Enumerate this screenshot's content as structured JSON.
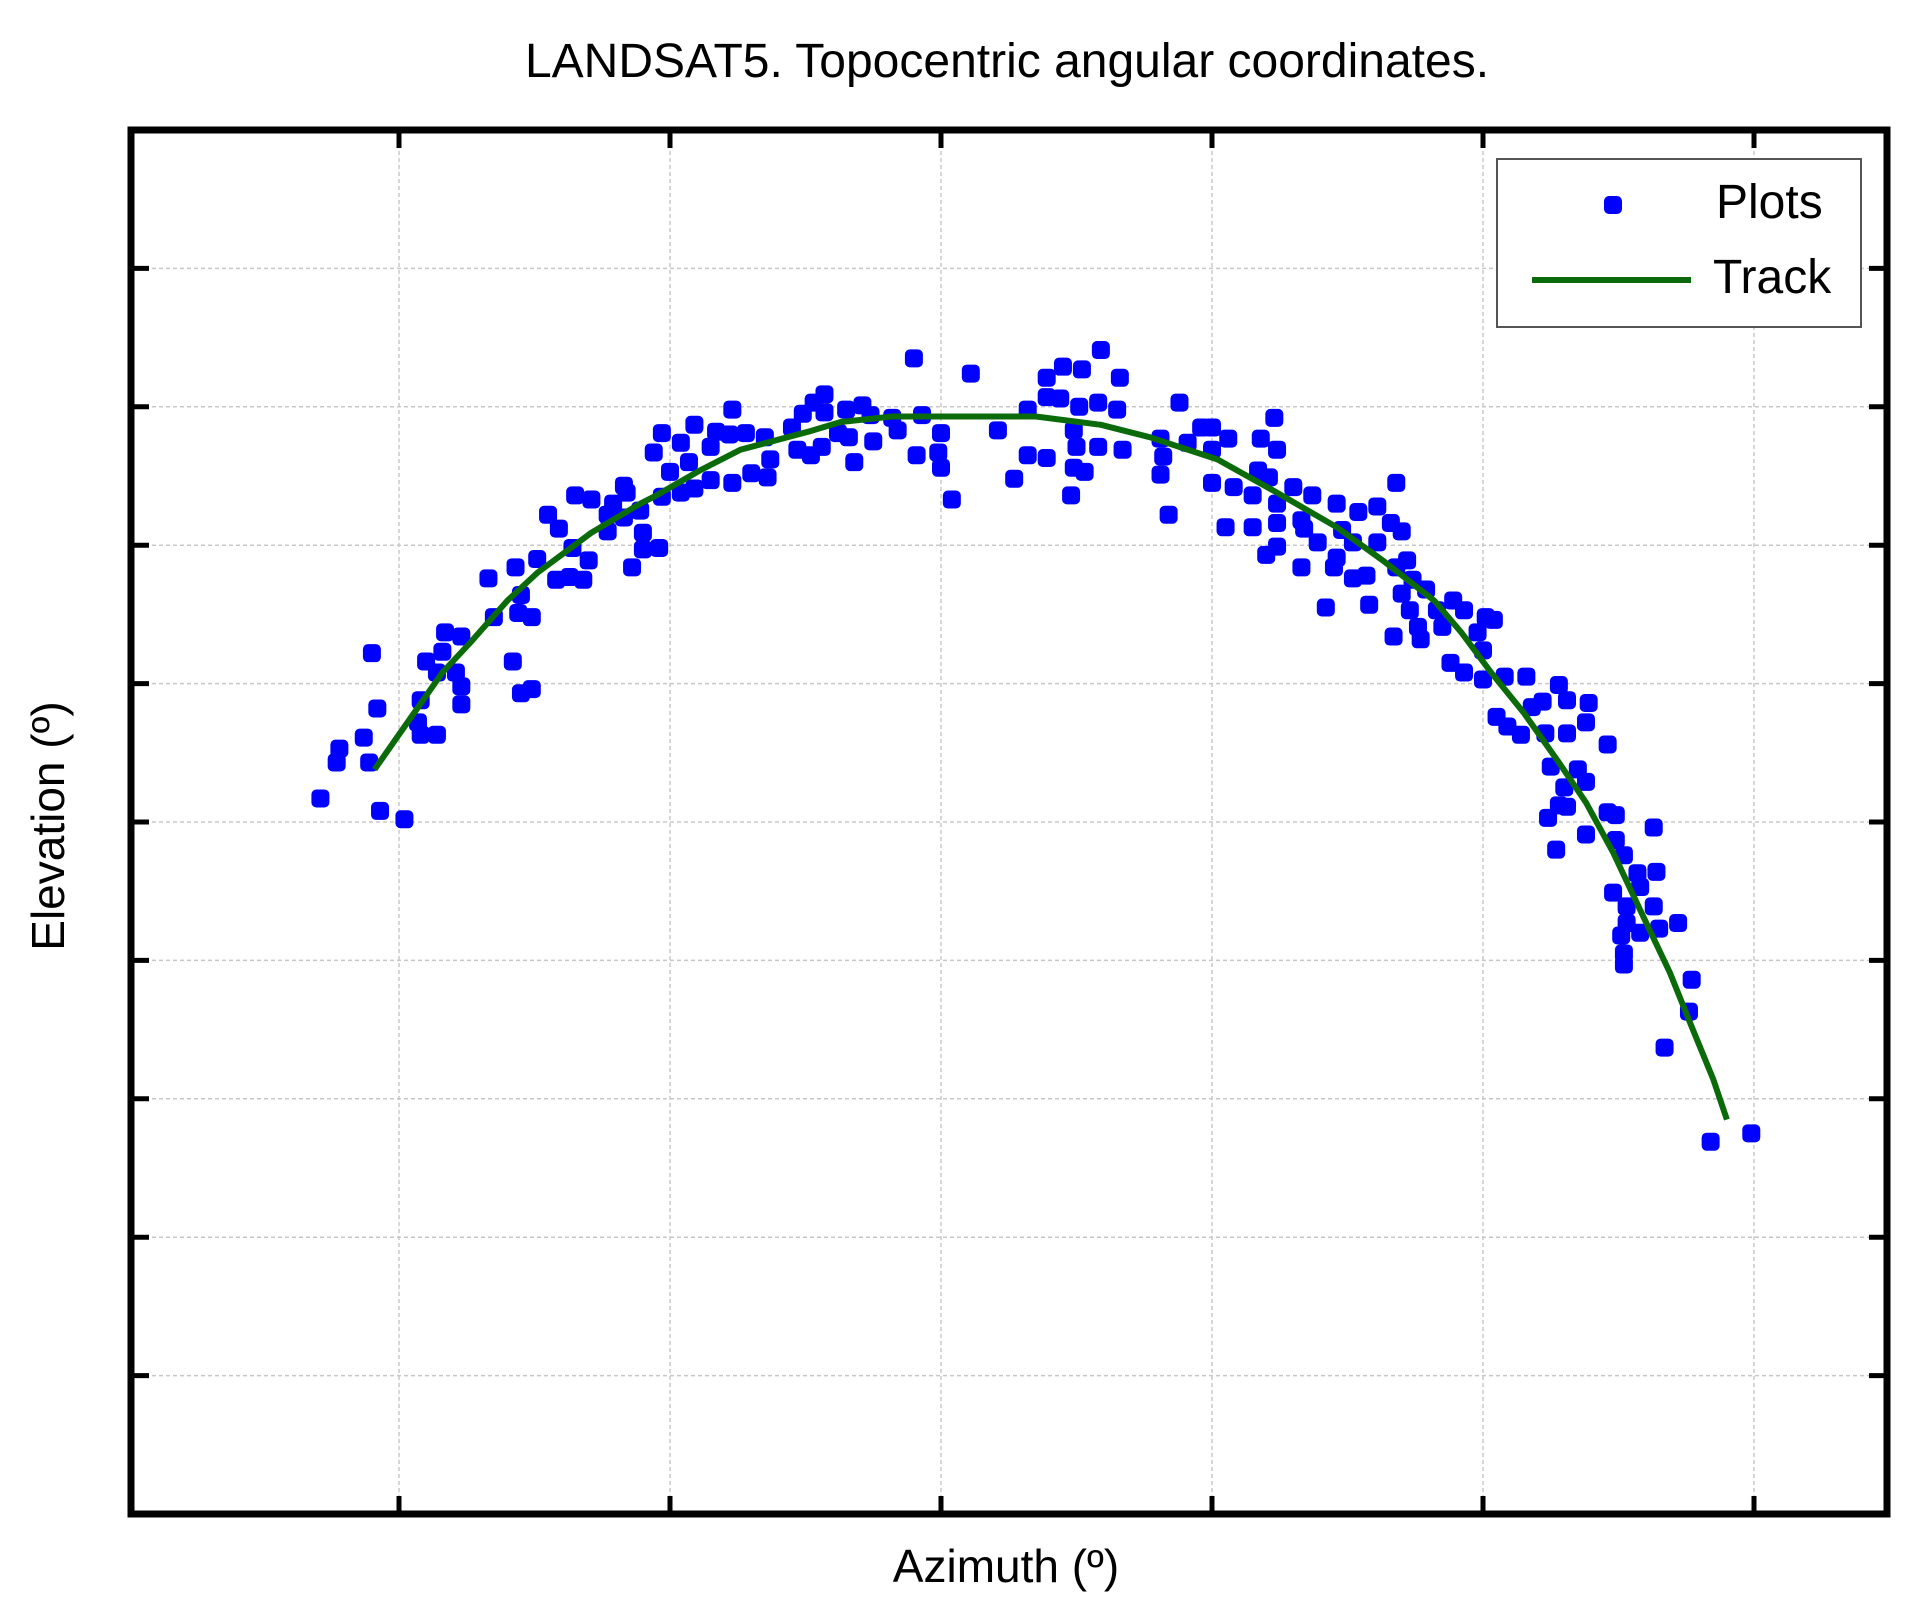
{
  "chart_data": {
    "type": "scatter",
    "title": "LANDSAT5. Topocentric angular coordinates.",
    "xlabel": "Azimuth (º)",
    "ylabel": "Elevation (º)",
    "axis_units_note": "Tick labels are not displayed; values are expressed in grid units (one unit per grid interval).",
    "xlim": [
      0,
      6.5
    ],
    "ylim": [
      0,
      10
    ],
    "xticks": [
      1,
      2,
      3,
      4,
      5,
      6
    ],
    "yticks": [
      1,
      2,
      3,
      4,
      5,
      6,
      7,
      8,
      9
    ],
    "xtick_labels": [
      "",
      "",
      "",
      "",
      "",
      ""
    ],
    "ytick_labels": [
      "",
      "",
      "",
      "",
      "",
      "",
      "",
      "",
      ""
    ],
    "grid": true,
    "legend": {
      "position": "top-right",
      "entries": [
        {
          "label": "Plots",
          "type": "marker",
          "color": "#0000ff"
        },
        {
          "label": "Track",
          "type": "line",
          "color": "#0b6b0b"
        }
      ]
    },
    "series": [
      {
        "name": "Plots",
        "type": "scatter",
        "marker": "rounded-square",
        "color": "#0000ff",
        "points": [
          [
            0.9,
            6.22
          ],
          [
            0.92,
            5.82
          ],
          [
            0.87,
            5.61
          ],
          [
            0.78,
            5.53
          ],
          [
            0.77,
            5.43
          ],
          [
            0.89,
            5.43
          ],
          [
            0.71,
            5.17
          ],
          [
            0.93,
            5.08
          ],
          [
            1.02,
            5.02
          ],
          [
            1.17,
            6.37
          ],
          [
            1.23,
            6.34
          ],
          [
            1.16,
            6.23
          ],
          [
            1.1,
            6.16
          ],
          [
            1.14,
            6.08
          ],
          [
            1.21,
            6.08
          ],
          [
            1.23,
            5.98
          ],
          [
            1.08,
            5.88
          ],
          [
            1.23,
            5.85
          ],
          [
            1.07,
            5.72
          ],
          [
            1.08,
            5.63
          ],
          [
            1.14,
            5.63
          ],
          [
            1.35,
            6.48
          ],
          [
            1.44,
            6.51
          ],
          [
            1.49,
            6.48
          ],
          [
            1.42,
            6.16
          ],
          [
            1.45,
            5.93
          ],
          [
            1.49,
            5.96
          ],
          [
            1.33,
            6.76
          ],
          [
            1.43,
            6.84
          ],
          [
            1.51,
            6.9
          ],
          [
            1.45,
            6.64
          ],
          [
            1.55,
            7.22
          ],
          [
            1.59,
            7.12
          ],
          [
            1.65,
            7.36
          ],
          [
            1.71,
            7.33
          ],
          [
            1.58,
            6.75
          ],
          [
            1.63,
            6.77
          ],
          [
            1.68,
            6.75
          ],
          [
            1.64,
            6.98
          ],
          [
            1.7,
            6.89
          ],
          [
            1.77,
            7.1
          ],
          [
            1.77,
            7.22
          ],
          [
            1.79,
            7.3
          ],
          [
            1.83,
            7.43
          ],
          [
            1.84,
            7.38
          ],
          [
            1.83,
            7.2
          ],
          [
            1.89,
            7.25
          ],
          [
            1.9,
            7.09
          ],
          [
            1.9,
            6.97
          ],
          [
            1.96,
            6.98
          ],
          [
            1.86,
            6.84
          ],
          [
            1.97,
            7.35
          ],
          [
            2.04,
            7.38
          ],
          [
            2.09,
            7.41
          ],
          [
            2.15,
            7.47
          ],
          [
            2.23,
            7.45
          ],
          [
            2.0,
            7.53
          ],
          [
            1.97,
            7.81
          ],
          [
            1.94,
            7.67
          ],
          [
            2.04,
            7.74
          ],
          [
            2.09,
            7.87
          ],
          [
            2.07,
            7.6
          ],
          [
            2.17,
            7.82
          ],
          [
            2.15,
            7.71
          ],
          [
            2.23,
            7.98
          ],
          [
            2.22,
            7.8
          ],
          [
            2.28,
            7.81
          ],
          [
            2.3,
            7.52
          ],
          [
            2.36,
            7.49
          ],
          [
            2.37,
            7.62
          ],
          [
            2.35,
            7.78
          ],
          [
            2.45,
            7.85
          ],
          [
            2.49,
            7.95
          ],
          [
            2.53,
            8.03
          ],
          [
            2.57,
            8.09
          ],
          [
            2.57,
            7.96
          ],
          [
            2.52,
            7.65
          ],
          [
            2.47,
            7.69
          ],
          [
            2.56,
            7.71
          ],
          [
            2.62,
            7.81
          ],
          [
            2.65,
            7.98
          ],
          [
            2.71,
            8.01
          ],
          [
            2.74,
            7.94
          ],
          [
            2.66,
            7.78
          ],
          [
            2.75,
            7.75
          ],
          [
            2.68,
            7.6
          ],
          [
            2.82,
            7.92
          ],
          [
            2.84,
            7.83
          ],
          [
            2.93,
            7.94
          ],
          [
            2.91,
            7.65
          ],
          [
            3.0,
            7.81
          ],
          [
            2.99,
            7.67
          ],
          [
            3.0,
            7.56
          ],
          [
            3.04,
            7.33
          ],
          [
            2.9,
            8.35
          ],
          [
            3.11,
            8.24
          ],
          [
            3.21,
            7.83
          ],
          [
            3.27,
            7.48
          ],
          [
            3.32,
            7.98
          ],
          [
            3.32,
            7.65
          ],
          [
            3.39,
            8.21
          ],
          [
            3.39,
            8.07
          ],
          [
            3.39,
            7.63
          ],
          [
            3.45,
            8.29
          ],
          [
            3.44,
            8.06
          ],
          [
            3.52,
            8.27
          ],
          [
            3.59,
            8.41
          ],
          [
            3.51,
            8.0
          ],
          [
            3.58,
            8.03
          ],
          [
            3.49,
            7.83
          ],
          [
            3.5,
            7.71
          ],
          [
            3.58,
            7.71
          ],
          [
            3.49,
            7.56
          ],
          [
            3.53,
            7.53
          ],
          [
            3.48,
            7.36
          ],
          [
            3.66,
            8.21
          ],
          [
            3.65,
            7.98
          ],
          [
            3.67,
            7.69
          ],
          [
            3.81,
            7.77
          ],
          [
            3.82,
            7.64
          ],
          [
            3.81,
            7.51
          ],
          [
            3.84,
            7.22
          ],
          [
            3.88,
            8.03
          ],
          [
            3.96,
            7.85
          ],
          [
            4.0,
            7.85
          ],
          [
            4.0,
            7.69
          ],
          [
            4.0,
            7.45
          ],
          [
            3.91,
            7.74
          ],
          [
            4.06,
            7.77
          ],
          [
            4.08,
            7.42
          ],
          [
            4.05,
            7.13
          ],
          [
            4.15,
            7.13
          ],
          [
            4.18,
            7.77
          ],
          [
            4.23,
            7.92
          ],
          [
            4.24,
            7.69
          ],
          [
            4.17,
            7.54
          ],
          [
            4.21,
            7.49
          ],
          [
            4.15,
            7.36
          ],
          [
            4.24,
            7.3
          ],
          [
            4.24,
            7.16
          ],
          [
            4.24,
            6.99
          ],
          [
            4.2,
            6.93
          ],
          [
            4.3,
            7.42
          ],
          [
            4.37,
            7.36
          ],
          [
            4.33,
            7.18
          ],
          [
            4.34,
            7.12
          ],
          [
            4.39,
            7.02
          ],
          [
            4.33,
            6.84
          ],
          [
            4.42,
            6.55
          ],
          [
            4.46,
            7.3
          ],
          [
            4.54,
            7.24
          ],
          [
            4.61,
            7.28
          ],
          [
            4.68,
            7.45
          ],
          [
            4.66,
            7.16
          ],
          [
            4.7,
            7.1
          ],
          [
            4.48,
            7.11
          ],
          [
            4.52,
            7.02
          ],
          [
            4.46,
            6.91
          ],
          [
            4.45,
            6.84
          ],
          [
            4.52,
            6.76
          ],
          [
            4.57,
            6.78
          ],
          [
            4.58,
            6.57
          ],
          [
            4.61,
            7.02
          ],
          [
            4.72,
            6.89
          ],
          [
            4.68,
            6.84
          ],
          [
            4.74,
            6.75
          ],
          [
            4.7,
            6.65
          ],
          [
            4.79,
            6.68
          ],
          [
            4.73,
            6.53
          ],
          [
            4.83,
            6.53
          ],
          [
            4.89,
            6.6
          ],
          [
            4.76,
            6.41
          ],
          [
            4.85,
            6.41
          ],
          [
            4.67,
            6.34
          ],
          [
            4.77,
            6.32
          ],
          [
            4.93,
            6.53
          ],
          [
            4.88,
            6.15
          ],
          [
            4.93,
            6.08
          ],
          [
            5.0,
            6.24
          ],
          [
            4.98,
            6.37
          ],
          [
            5.01,
            6.48
          ],
          [
            5.04,
            6.46
          ],
          [
            5.0,
            6.03
          ],
          [
            5.08,
            6.05
          ],
          [
            5.16,
            6.05
          ],
          [
            5.28,
            5.99
          ],
          [
            5.31,
            5.88
          ],
          [
            5.39,
            5.86
          ],
          [
            5.38,
            5.72
          ],
          [
            5.22,
            5.87
          ],
          [
            5.05,
            5.76
          ],
          [
            5.09,
            5.69
          ],
          [
            5.14,
            5.63
          ],
          [
            5.18,
            5.83
          ],
          [
            5.23,
            5.64
          ],
          [
            5.31,
            5.64
          ],
          [
            5.46,
            5.56
          ],
          [
            5.25,
            5.4
          ],
          [
            5.35,
            5.38
          ],
          [
            5.38,
            5.29
          ],
          [
            5.3,
            5.25
          ],
          [
            5.28,
            5.12
          ],
          [
            5.31,
            5.11
          ],
          [
            5.24,
            5.03
          ],
          [
            5.46,
            5.07
          ],
          [
            5.49,
            5.05
          ],
          [
            5.38,
            4.91
          ],
          [
            5.49,
            4.87
          ],
          [
            5.63,
            4.96
          ],
          [
            5.27,
            4.8
          ],
          [
            5.52,
            4.76
          ],
          [
            5.57,
            4.63
          ],
          [
            5.64,
            4.64
          ],
          [
            5.48,
            4.49
          ],
          [
            5.58,
            4.53
          ],
          [
            5.53,
            4.39
          ],
          [
            5.63,
            4.39
          ],
          [
            5.53,
            4.27
          ],
          [
            5.51,
            4.18
          ],
          [
            5.58,
            4.2
          ],
          [
            5.65,
            4.23
          ],
          [
            5.72,
            4.27
          ],
          [
            5.52,
            4.05
          ],
          [
            5.52,
            3.97
          ],
          [
            5.77,
            3.86
          ],
          [
            5.76,
            3.63
          ],
          [
            5.67,
            3.37
          ],
          [
            5.84,
            2.69
          ],
          [
            5.99,
            2.75
          ]
        ]
      },
      {
        "name": "Track",
        "type": "line",
        "color": "#0b6b0b",
        "points": [
          [
            0.91,
            5.38
          ],
          [
            1.16,
            6.08
          ],
          [
            1.26,
            6.29
          ],
          [
            1.4,
            6.6
          ],
          [
            1.51,
            6.8
          ],
          [
            1.71,
            7.09
          ],
          [
            1.89,
            7.3
          ],
          [
            1.95,
            7.36
          ],
          [
            2.11,
            7.54
          ],
          [
            2.26,
            7.69
          ],
          [
            2.51,
            7.82
          ],
          [
            2.63,
            7.89
          ],
          [
            2.82,
            7.93
          ],
          [
            3.0,
            7.93
          ],
          [
            3.2,
            7.93
          ],
          [
            3.35,
            7.93
          ],
          [
            3.59,
            7.87
          ],
          [
            3.77,
            7.78
          ],
          [
            4.02,
            7.62
          ],
          [
            4.24,
            7.38
          ],
          [
            4.46,
            7.13
          ],
          [
            4.63,
            6.89
          ],
          [
            4.82,
            6.6
          ],
          [
            4.92,
            6.37
          ],
          [
            5.03,
            6.08
          ],
          [
            5.15,
            5.79
          ],
          [
            5.28,
            5.43
          ],
          [
            5.38,
            5.14
          ],
          [
            5.48,
            4.78
          ],
          [
            5.61,
            4.24
          ],
          [
            5.69,
            3.91
          ],
          [
            5.77,
            3.52
          ],
          [
            5.85,
            3.14
          ],
          [
            5.9,
            2.85
          ]
        ]
      }
    ]
  }
}
